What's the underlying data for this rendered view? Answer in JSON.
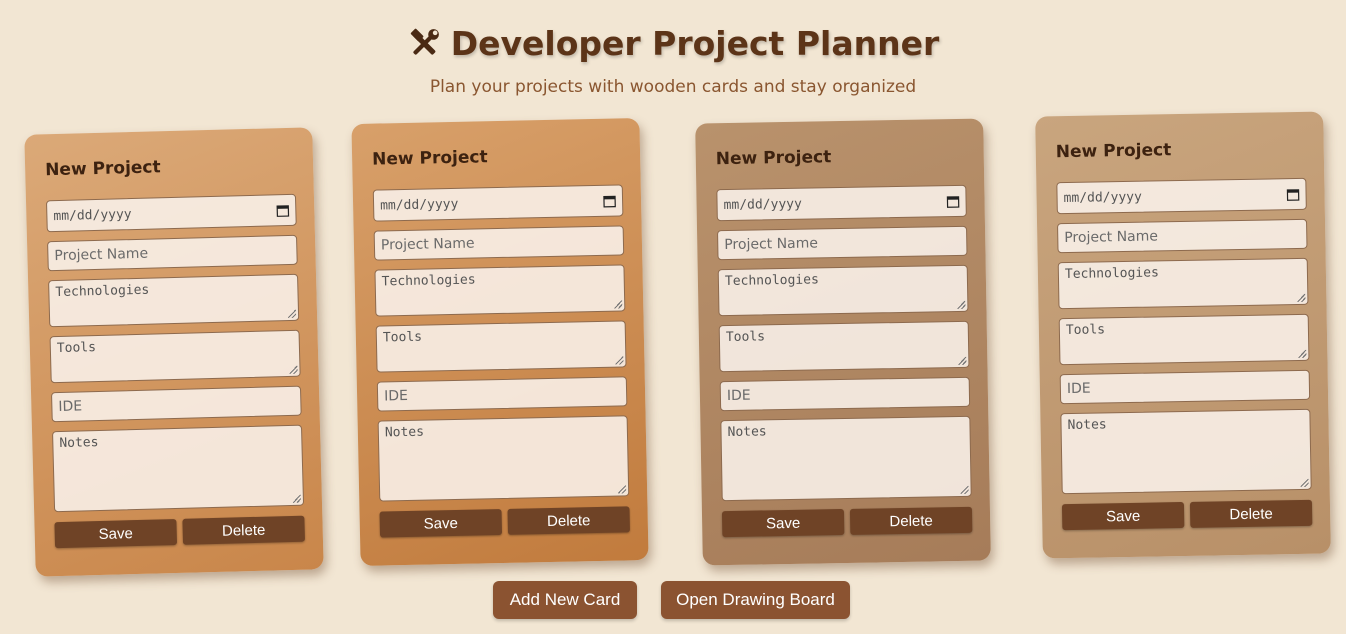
{
  "header": {
    "icon": "hammer-wrench-icon",
    "title": "Developer Project Planner",
    "subtitle": "Plan your projects with wooden cards and stay organized"
  },
  "cards": [
    {
      "title": "New Project",
      "date_placeholder": "mm/dd/yyyy",
      "project_name_placeholder": "Project Name",
      "technologies_placeholder": "Technologies",
      "tools_placeholder": "Tools",
      "ide_placeholder": "IDE",
      "notes_placeholder": "Notes",
      "save_label": "Save",
      "delete_label": "Delete",
      "color_top": "#dba978",
      "color_bottom": "#c9864a"
    },
    {
      "title": "New Project",
      "date_placeholder": "mm/dd/yyyy",
      "project_name_placeholder": "Project Name",
      "technologies_placeholder": "Technologies",
      "tools_placeholder": "Tools",
      "ide_placeholder": "IDE",
      "notes_placeholder": "Notes",
      "save_label": "Save",
      "delete_label": "Delete",
      "color_top": "#d8a06a",
      "color_bottom": "#c17b3d"
    },
    {
      "title": "New Project",
      "date_placeholder": "mm/dd/yyyy",
      "project_name_placeholder": "Project Name",
      "technologies_placeholder": "Technologies",
      "tools_placeholder": "Tools",
      "ide_placeholder": "IDE",
      "notes_placeholder": "Notes",
      "save_label": "Save",
      "delete_label": "Delete",
      "color_top": "#b9926c",
      "color_bottom": "#a67c59"
    },
    {
      "title": "New Project",
      "date_placeholder": "mm/dd/yyyy",
      "project_name_placeholder": "Project Name",
      "technologies_placeholder": "Technologies",
      "tools_placeholder": "Tools",
      "ide_placeholder": "IDE",
      "notes_placeholder": "Notes",
      "save_label": "Save",
      "delete_label": "Delete",
      "color_top": "#c9a57e",
      "color_bottom": "#b89068"
    }
  ],
  "actions": {
    "add_card_label": "Add New Card",
    "drawing_board_label": "Open Drawing Board"
  },
  "colors": {
    "background": "#f2e6d3",
    "title": "#5c3418",
    "subtitle": "#8a5630",
    "button": "#6f4326",
    "action_button": "#8b5331"
  }
}
